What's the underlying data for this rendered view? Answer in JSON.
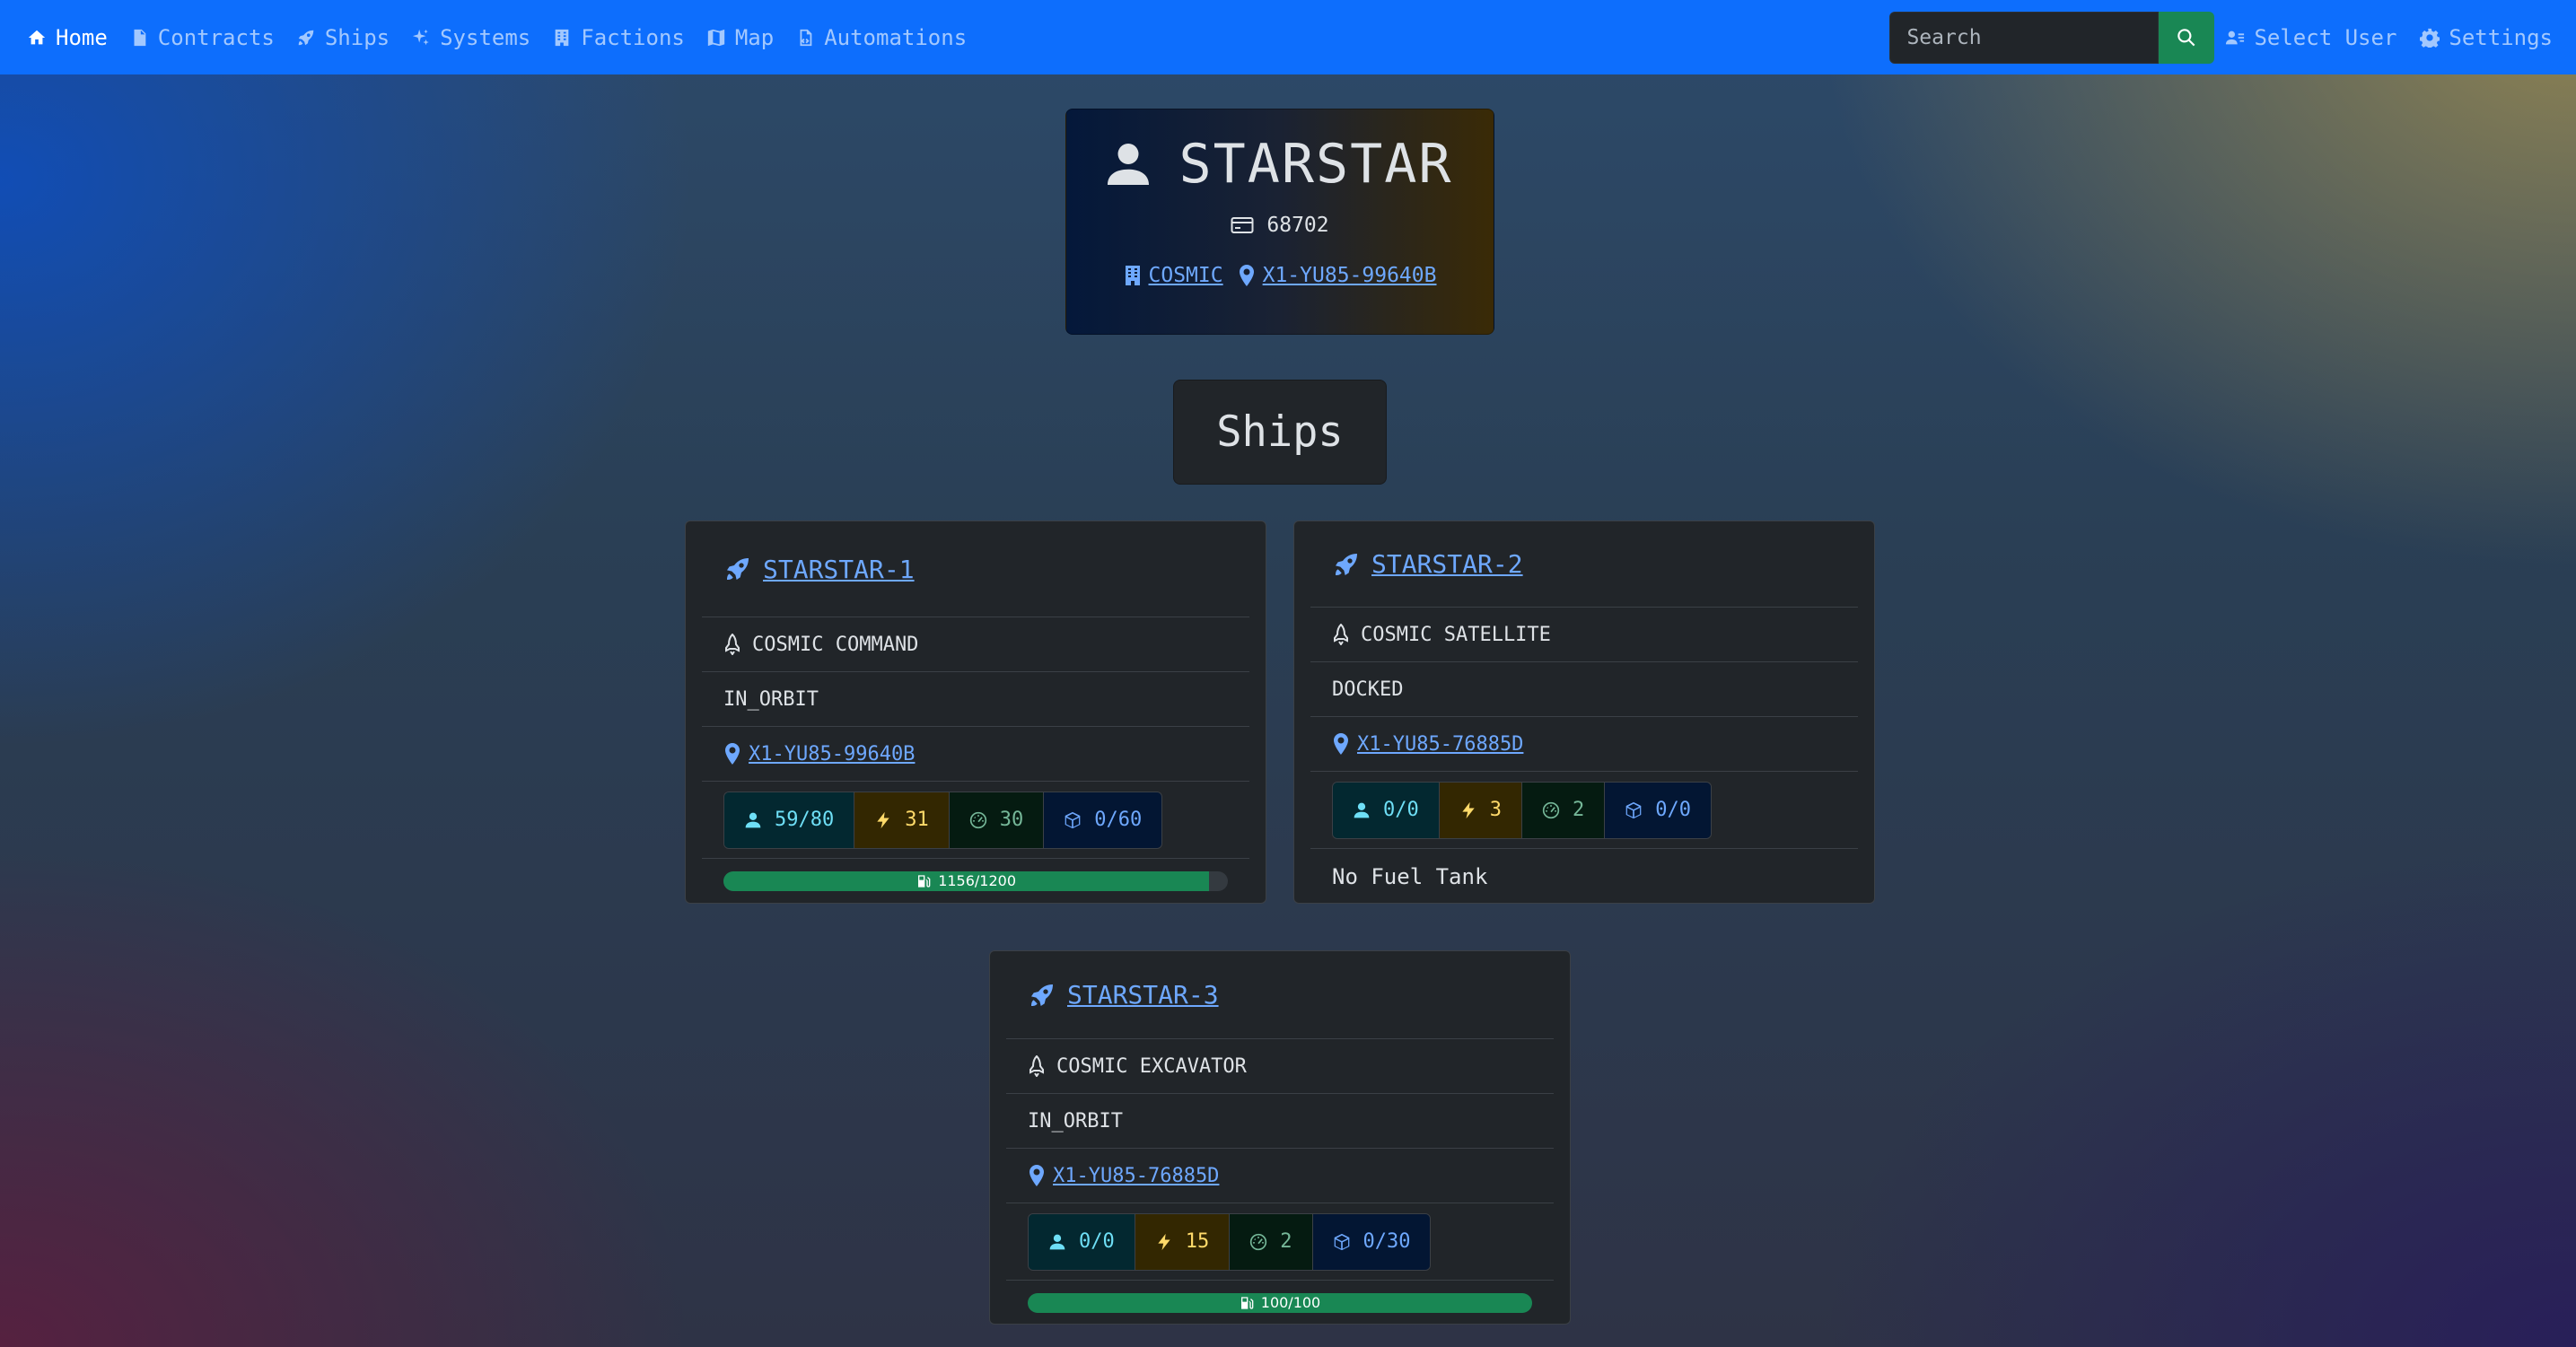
{
  "nav": {
    "items": [
      {
        "label": "Home",
        "icon": "house-icon"
      },
      {
        "label": "Contracts",
        "icon": "document-icon"
      },
      {
        "label": "Ships",
        "icon": "rocket-icon"
      },
      {
        "label": "Systems",
        "icon": "sparkles-icon"
      },
      {
        "label": "Factions",
        "icon": "building-icon"
      },
      {
        "label": "Map",
        "icon": "map-icon"
      },
      {
        "label": "Automations",
        "icon": "file-code-icon"
      }
    ],
    "search_placeholder": "Search",
    "select_user": "Select User",
    "settings": "Settings",
    "colors": {
      "navbar": "#0d6efd",
      "search_button": "#198754"
    }
  },
  "agent": {
    "name": "STARSTAR",
    "credits": "68702",
    "faction": "COSMIC",
    "headquarters": "X1-YU85-99640B"
  },
  "ships_heading": "Ships",
  "ships": [
    {
      "name": "STARSTAR-1",
      "role": "COSMIC COMMAND",
      "status": "IN_ORBIT",
      "waypoint": "X1-YU85-99640B",
      "crew": "59/80",
      "power": "31",
      "engine": "30",
      "cargo": "0/60",
      "fuel_label": "1156/1200",
      "fuel_fraction": 0.963
    },
    {
      "name": "STARSTAR-2",
      "role": "COSMIC SATELLITE",
      "status": "DOCKED",
      "waypoint": "X1-YU85-76885D",
      "crew": "0/0",
      "power": "3",
      "engine": "2",
      "cargo": "0/0",
      "fuel_text": "No Fuel Tank"
    },
    {
      "name": "STARSTAR-3",
      "role": "COSMIC EXCAVATOR",
      "status": "IN_ORBIT",
      "waypoint": "X1-YU85-76885D",
      "crew": "0/0",
      "power": "15",
      "engine": "2",
      "cargo": "0/30",
      "fuel_label": "100/100",
      "fuel_fraction": 1.0
    }
  ]
}
